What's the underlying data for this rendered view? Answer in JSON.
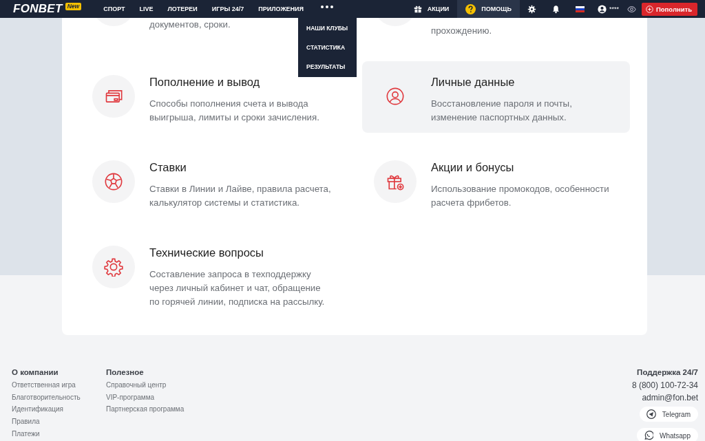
{
  "header": {
    "logo": "FONBET",
    "badge": "New",
    "nav": [
      {
        "label": "СПОРТ",
        "selected": false
      },
      {
        "label": "LIVE",
        "selected": false
      },
      {
        "label": "ЛОТЕРЕИ",
        "selected": false
      },
      {
        "label": "ИГРЫ 24/7",
        "selected": false
      },
      {
        "label": "ПРИЛОЖЕНИЯ",
        "selected": false
      }
    ],
    "more_menu": {
      "expanded": true,
      "items": [
        "НАШИ КЛУБЫ",
        "СТАТИСТИКА",
        "РЕЗУЛЬТАТЫ"
      ]
    },
    "links": [
      {
        "kind": "gift",
        "label": "АКЦИИ",
        "selected": false
      },
      {
        "kind": "help",
        "label": "ПОМОЩЬ",
        "selected": true
      }
    ],
    "user_masked": "****",
    "deposit_button": "Пополнить"
  },
  "cut_topics": [
    {
      "kind": "left",
      "description_lines": [
        "документов, сроки."
      ]
    },
    {
      "kind": "right",
      "description_lines": [
        "прохождению."
      ]
    }
  ],
  "topics": [
    {
      "kind": "card",
      "title": "Пополнение и вывод",
      "description_lines": [
        "Способы пополнения счета и вывода",
        "выигрыша, лимиты и сроки зачисления."
      ],
      "highlighted": false
    },
    {
      "kind": "user",
      "title": "Личные данные",
      "description_lines": [
        "Восстановление пароля и почты,",
        "изменение паспортных данных."
      ],
      "highlighted": true
    },
    {
      "kind": "ball",
      "title": "Ставки",
      "description_lines": [
        "Ставки в Линии и Лайве, правила расчета,",
        "калькулятор системы и статистика."
      ],
      "highlighted": false
    },
    {
      "kind": "gift",
      "title": "Акции и бонусы",
      "description_lines": [
        "Использование промокодов, особенности",
        "расчета фрибетов."
      ],
      "highlighted": false
    },
    {
      "kind": "gear",
      "title": "Технические вопросы",
      "description_lines": [
        "Составление запроса в техподдержку",
        "через личный кабинет и чат, обращение",
        "по горячей линии, подписка на рассылку."
      ],
      "highlighted": false
    }
  ],
  "footer": {
    "columns": [
      {
        "heading": "О компании",
        "links": [
          "Ответственная игра",
          "Благотворительность",
          "Идентификация",
          "Правила",
          "Платежи"
        ]
      },
      {
        "heading": "Полезное",
        "links": [
          "Справочный центр",
          "VIP-программа",
          "Партнерская программа"
        ]
      }
    ],
    "support": {
      "heading": "Поддержка 24/7",
      "phone": "8 (800) 100-72-34",
      "email": "admin@fon.bet",
      "messengers": [
        {
          "kind": "telegram",
          "label": "Telegram"
        },
        {
          "kind": "whatsapp",
          "label": "Whatsapp"
        }
      ]
    }
  }
}
